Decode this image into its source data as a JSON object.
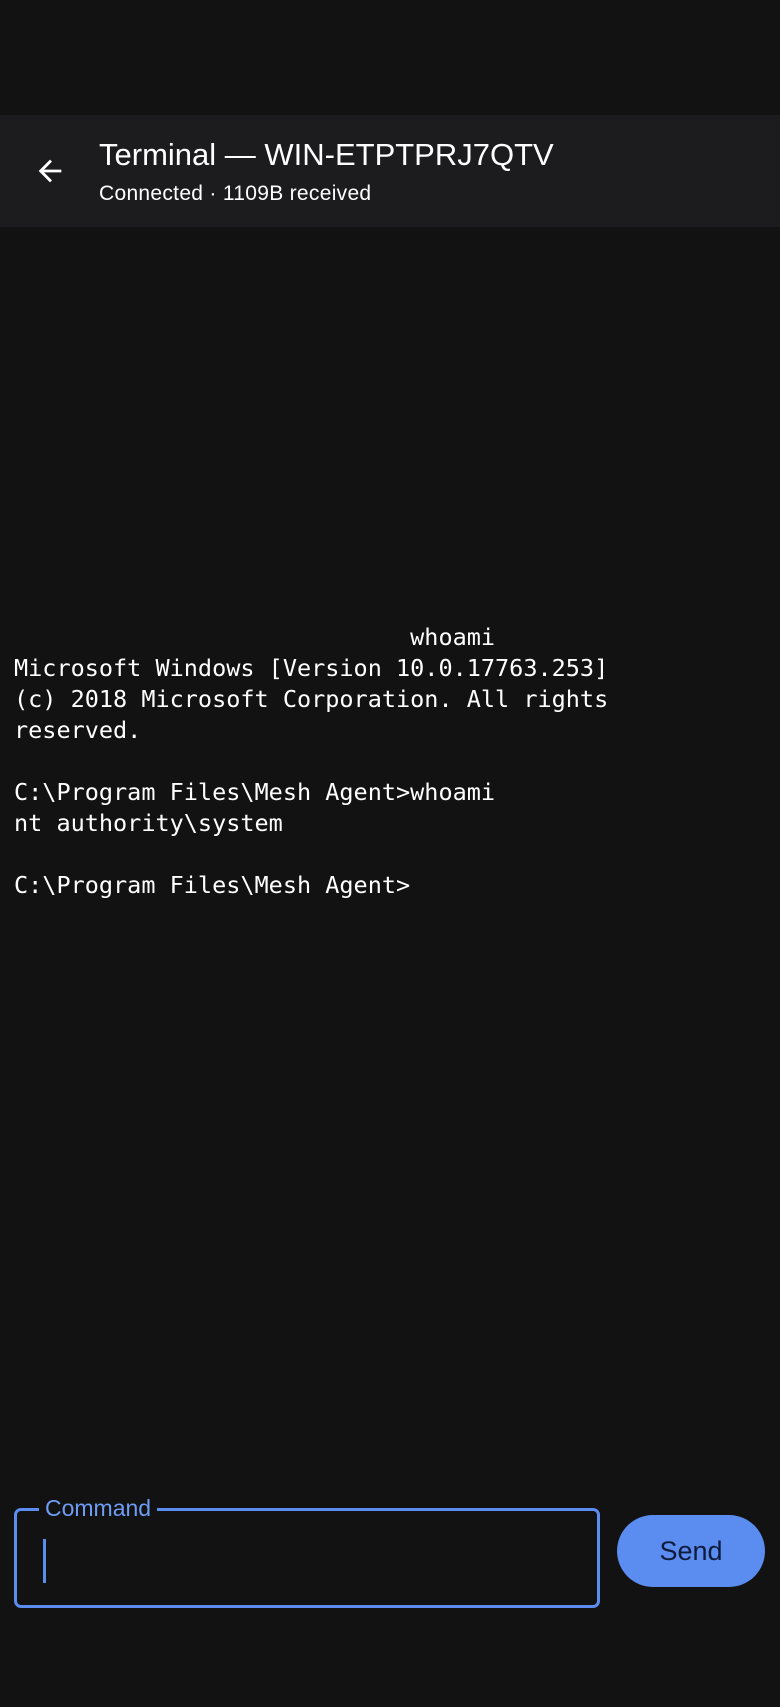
{
  "app_bar": {
    "title": "Terminal — WIN-ETPTPRJ7QTV",
    "subtitle": "Connected · 1109B received"
  },
  "terminal": {
    "output": "                            whoami\nMicrosoft Windows [Version 10.0.17763.253]\n(c) 2018 Microsoft Corporation. All rights\nreserved.\n\nC:\\Program Files\\Mesh Agent>whoami\nnt authority\\system\n\nC:\\Program Files\\Mesh Agent>"
  },
  "command": {
    "label": "Command",
    "value": "",
    "send_label": "Send"
  },
  "colors": {
    "background": "#121212",
    "app_bar": "#1c1c1e",
    "accent": "#5b8cf0",
    "send_text": "#0e1b3a"
  }
}
